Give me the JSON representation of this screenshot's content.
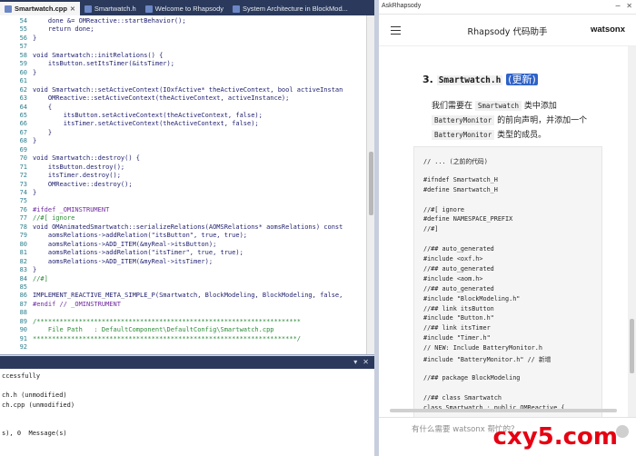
{
  "editor_tabs": [
    {
      "label": "Smartwatch.cpp",
      "active": true
    },
    {
      "label": "Smartwatch.h",
      "active": false
    },
    {
      "label": "Welcome to Rhapsody",
      "active": false
    },
    {
      "label": "System Architecture in BlockMod...",
      "active": false
    }
  ],
  "code_lines": [
    {
      "n": "54",
      "t": "    done &= OMReactive::startBehavior();",
      "k": "n"
    },
    {
      "n": "55",
      "t": "    return done;",
      "k": "n"
    },
    {
      "n": "56",
      "t": "}",
      "k": "n"
    },
    {
      "n": "57",
      "t": "",
      "k": "n"
    },
    {
      "n": "58",
      "t": "void Smartwatch::initRelations() {",
      "k": "n"
    },
    {
      "n": "59",
      "t": "    itsButton.setItsTimer(&itsTimer);",
      "k": "n"
    },
    {
      "n": "60",
      "t": "}",
      "k": "n"
    },
    {
      "n": "61",
      "t": "",
      "k": "n"
    },
    {
      "n": "62",
      "t": "void Smartwatch::setActiveContext(IOxfActive* theActiveContext, bool activeInstan",
      "k": "n"
    },
    {
      "n": "63",
      "t": "    OMReactive::setActiveContext(theActiveContext, activeInstance);",
      "k": "n"
    },
    {
      "n": "64",
      "t": "    {",
      "k": "n"
    },
    {
      "n": "65",
      "t": "        itsButton.setActiveContext(theActiveContext, false);",
      "k": "n"
    },
    {
      "n": "66",
      "t": "        itsTimer.setActiveContext(theActiveContext, false);",
      "k": "n"
    },
    {
      "n": "67",
      "t": "    }",
      "k": "n"
    },
    {
      "n": "68",
      "t": "}",
      "k": "n"
    },
    {
      "n": "69",
      "t": "",
      "k": "n"
    },
    {
      "n": "70",
      "t": "void Smartwatch::destroy() {",
      "k": "n"
    },
    {
      "n": "71",
      "t": "    itsButton.destroy();",
      "k": "n"
    },
    {
      "n": "72",
      "t": "    itsTimer.destroy();",
      "k": "n"
    },
    {
      "n": "73",
      "t": "    OMReactive::destroy();",
      "k": "n"
    },
    {
      "n": "74",
      "t": "}",
      "k": "n"
    },
    {
      "n": "75",
      "t": "",
      "k": "n"
    },
    {
      "n": "76",
      "t": "#ifdef _OMINSTRUMENT",
      "k": "pp"
    },
    {
      "n": "77",
      "t": "//#[ ignore",
      "k": "cm"
    },
    {
      "n": "78",
      "t": "void OMAnimatedSmartwatch::serializeRelations(AOMSRelations* aomsRelations) const",
      "k": "n"
    },
    {
      "n": "79",
      "t": "    aomsRelations->addRelation(\"itsButton\", true, true);",
      "k": "n"
    },
    {
      "n": "80",
      "t": "    aomsRelations->ADD_ITEM(&myReal->itsButton);",
      "k": "n"
    },
    {
      "n": "81",
      "t": "    aomsRelations->addRelation(\"itsTimer\", true, true);",
      "k": "n"
    },
    {
      "n": "82",
      "t": "    aomsRelations->ADD_ITEM(&myReal->itsTimer);",
      "k": "n"
    },
    {
      "n": "83",
      "t": "}",
      "k": "n"
    },
    {
      "n": "84",
      "t": "//#]",
      "k": "cm"
    },
    {
      "n": "85",
      "t": "",
      "k": "n"
    },
    {
      "n": "86",
      "t": "IMPLEMENT_REACTIVE_META_SIMPLE_P(Smartwatch, BlockModeling, BlockModeling, false,",
      "k": "n"
    },
    {
      "n": "87",
      "t": "#endif // _OMINSTRUMENT",
      "k": "pp"
    },
    {
      "n": "88",
      "t": "",
      "k": "n"
    },
    {
      "n": "89",
      "t": "/*********************************************************************",
      "k": "cm"
    },
    {
      "n": "90",
      "t": "    File Path   : DefaultComponent\\DefaultConfig\\Smartwatch.cpp",
      "k": "cm"
    },
    {
      "n": "91",
      "t": "*********************************************************************/",
      "k": "cm"
    },
    {
      "n": "92",
      "t": "",
      "k": "n"
    }
  ],
  "output_lines": [
    "ccessfully",
    "",
    "ch.h (unmodified)",
    "ch.cpp (unmodified)",
    "",
    "",
    "s), 0  Message(s)"
  ],
  "side": {
    "window_title": "AskRhapsody",
    "app_title": "Rhapsody 代码助手",
    "brand": "watsonx",
    "heading_num": "3.",
    "heading_file": "Smartwatch.h",
    "heading_tag": "(更新)",
    "para_1": "我们需要在",
    "para_code_1": "Smartwatch",
    "para_2": "类中添加",
    "para_code_2": "BatteryMonitor",
    "para_3": "的前向声明，并添加一个",
    "para_code_3": "BatteryMonitor",
    "para_4": "类型的成员。",
    "code_lines": [
      "// ... (之前的代码)",
      "",
      "#ifndef Smartwatch_H",
      "#define Smartwatch_H",
      "",
      "//#[ ignore",
      "#define NAMESPACE_PREFIX",
      "//#]",
      "",
      "//## auto_generated",
      "#include <oxf.h>",
      "//## auto_generated",
      "#include <aom.h>",
      "//## auto_generated",
      "#include \"BlockModeling.h\"",
      "//## link itsButton",
      "#include \"Button.h\"",
      "//## link itsTimer",
      "#include \"Timer.h\"",
      "// NEW: Include BatteryMonitor.h",
      "#include \"BatteryMonitor.h\" // 新增",
      "",
      "//## package BlockModeling",
      "",
      "//## class Smartwatch",
      "class Smartwatch : public OMReactive {"
    ],
    "input_placeholder": "有什么需要 watsonx 帮忙的？"
  },
  "watermark": "cxy5.com"
}
